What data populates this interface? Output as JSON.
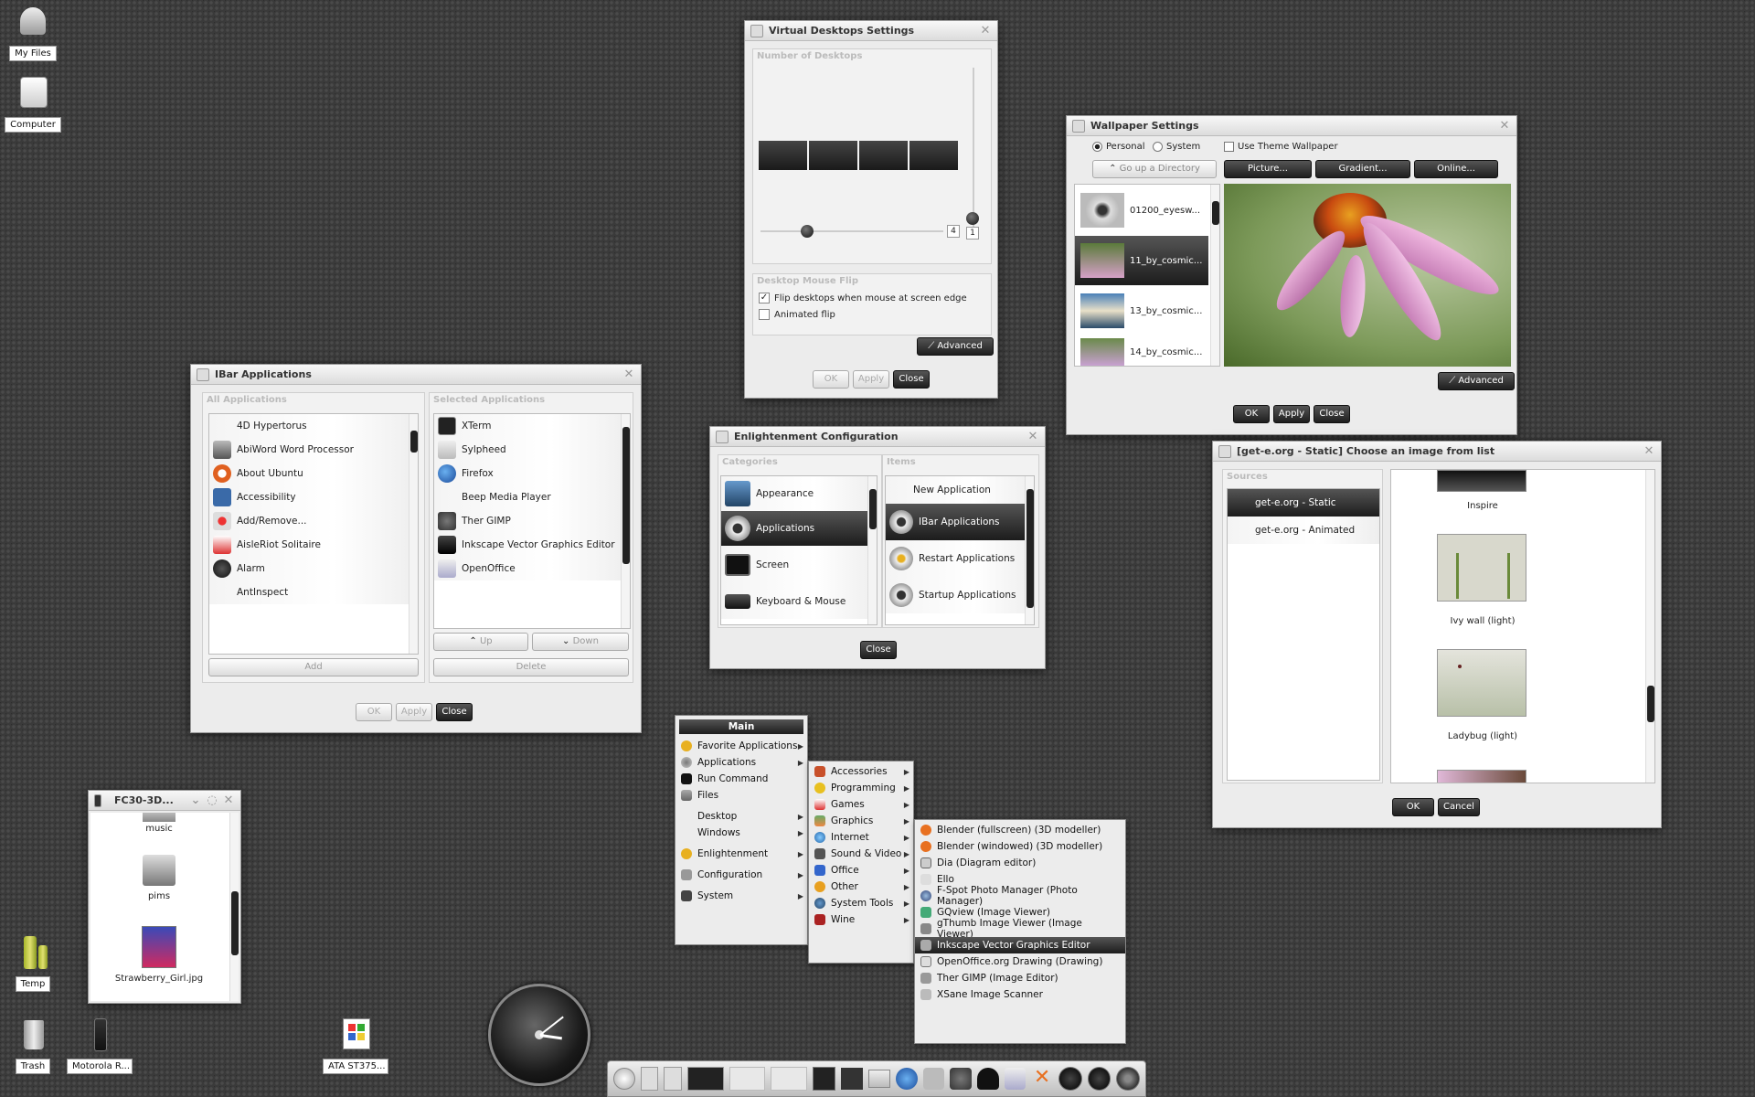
{
  "desktop": {
    "icons": {
      "my_files": "My Files",
      "computer": "Computer",
      "temp": "Temp",
      "trash": "Trash",
      "motorola": "Motorola R...",
      "ata": "ATA ST375..."
    }
  },
  "virtual_desktops": {
    "title": "Virtual Desktops Settings",
    "number_frame": "Number of Desktops",
    "rows_value": "1",
    "cols_value": "4",
    "flip_frame": "Desktop Mouse Flip",
    "flip_edge": "Flip desktops when mouse at screen edge",
    "animated_flip": "Animated flip",
    "advanced": "Advanced",
    "ok": "OK",
    "apply": "Apply",
    "close": "Close"
  },
  "wallpaper": {
    "title": "Wallpaper Settings",
    "personal": "Personal",
    "system": "System",
    "use_theme": "Use Theme Wallpaper",
    "go_up": "Go up a Directory",
    "picture": "Picture...",
    "gradient": "Gradient...",
    "online": "Online...",
    "files": [
      "01200_eyesw...",
      "11_by_cosmic...",
      "13_by_cosmic...",
      "14_by_cosmic..."
    ],
    "advanced": "Advanced",
    "ok": "OK",
    "apply": "Apply",
    "close": "Close"
  },
  "ibar": {
    "title": "IBar Applications",
    "all_frame": "All Applications",
    "selected_frame": "Selected Applications",
    "all_apps": [
      "4D Hypertorus",
      "AbiWord Word Processor",
      "About Ubuntu",
      "Accessibility",
      "Add/Remove...",
      "AisleRiot Solitaire",
      "Alarm",
      "AntInspect"
    ],
    "selected_apps": [
      "XTerm",
      "Sylpheed",
      "Firefox",
      "Beep Media Player",
      "Ther GIMP",
      "Inkscape Vector Graphics Editor",
      "OpenOffice"
    ],
    "add": "Add",
    "up": "Up",
    "down": "Down",
    "delete": "Delete",
    "ok": "OK",
    "apply": "Apply",
    "close": "Close"
  },
  "config": {
    "title": "Enlightenment Configuration",
    "categories_frame": "Categories",
    "items_frame": "Items",
    "categories": [
      "Appearance",
      "Applications",
      "Screen",
      "Keyboard & Mouse"
    ],
    "items": [
      "New Application",
      "IBar Applications",
      "Restart Applications",
      "Startup Applications"
    ],
    "close": "Close"
  },
  "gete": {
    "title": "[get-e.org - Static] Choose an image from list",
    "sources_frame": "Sources",
    "sources": [
      "get-e.org - Static",
      "get-e.org  - Animated"
    ],
    "images": [
      "Inspire",
      "Ivy wall (light)",
      "Ladybug (light)"
    ],
    "ok": "OK",
    "cancel": "Cancel"
  },
  "filewin": {
    "title": "FC30-3D...",
    "items": [
      "music",
      "pims",
      "Strawberry_Girl.jpg"
    ]
  },
  "main_menu": {
    "header": "Main",
    "items": [
      "Favorite Applications",
      "Applications",
      "Run Command",
      "Files",
      "Desktop",
      "Windows",
      "Enlightenment",
      "Configuration",
      "System"
    ]
  },
  "apps_menu": {
    "items": [
      "Accessories",
      "Programming",
      "Games",
      "Graphics",
      "Internet",
      "Sound & Video",
      "Office",
      "Other",
      "System Tools",
      "Wine"
    ]
  },
  "graphics_menu": {
    "items": [
      "Blender (fullscreen) (3D modeller)",
      "Blender (windowed) (3D modeller)",
      "Dia  (Diagram editor)",
      "Ello",
      "F-Spot Photo Manager (Photo Manager)",
      "GQview (Image Viewer)",
      "gThumb Image Viewer (Image Viewer)",
      "Inkscape Vector Graphics Editor",
      "OpenOffice.org Drawing (Drawing)",
      "Ther GIMP (Image Editor)",
      "XSane Image Scanner"
    ]
  }
}
